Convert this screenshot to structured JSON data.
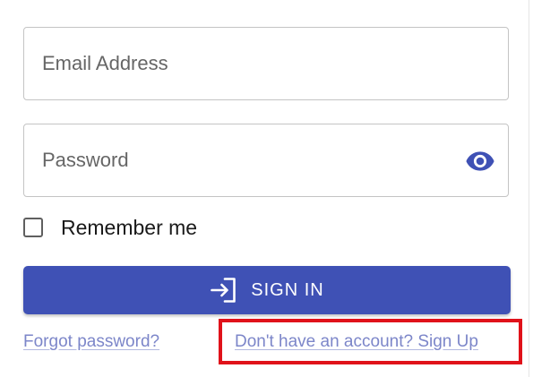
{
  "form": {
    "email": {
      "value": "",
      "placeholder": "Email Address"
    },
    "password": {
      "value": "",
      "placeholder": "Password",
      "visibility_icon": "eye-icon"
    },
    "remember": {
      "label": "Remember me",
      "checked": false
    },
    "signin": {
      "label": "SIGN IN",
      "icon": "login-icon"
    },
    "links": {
      "forgot": "Forgot password?",
      "signup": "Don't have an account? Sign Up"
    }
  },
  "colors": {
    "primary": "#3f51b5",
    "link": "#7c86c9",
    "highlight": "#e0121a",
    "border": "#c4c4c4"
  }
}
